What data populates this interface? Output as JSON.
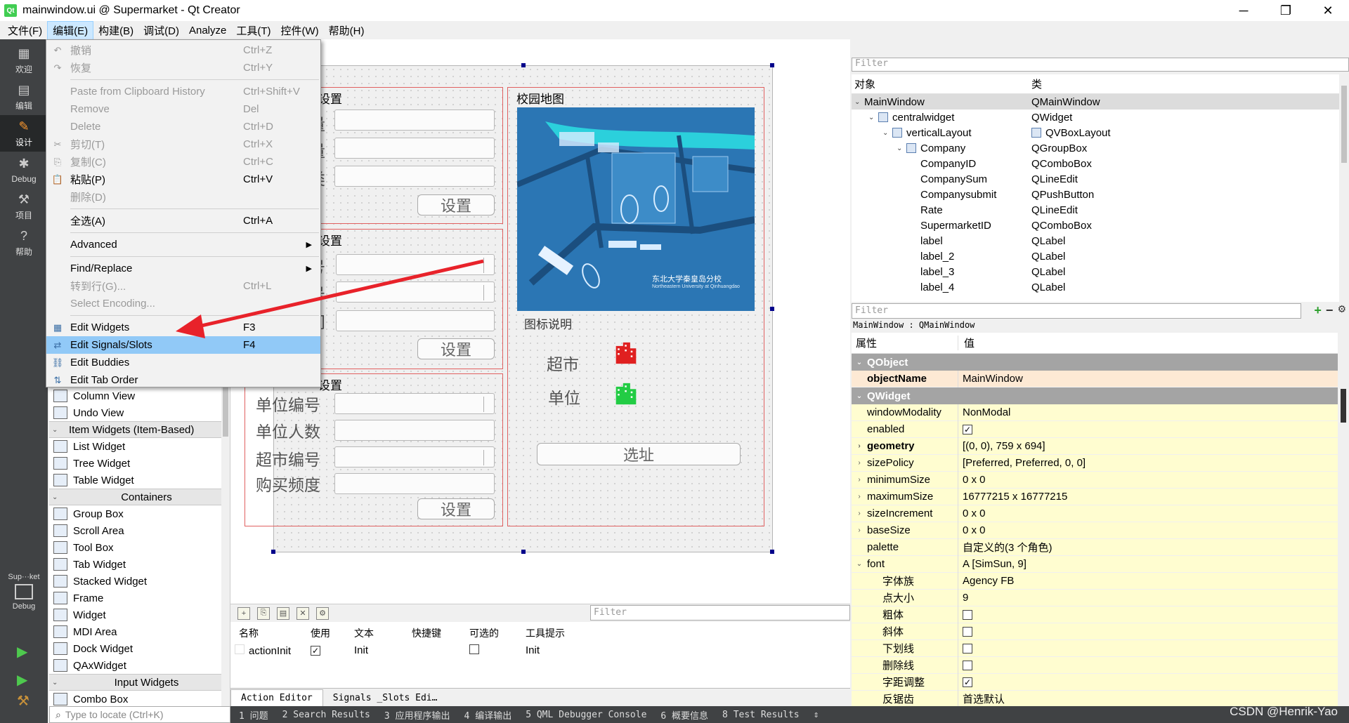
{
  "window": {
    "title": "mainwindow.ui @ Supermarket - Qt Creator",
    "app_icon_label": "Qt",
    "minimize": "─",
    "maximize": "❐",
    "close": "✕"
  },
  "menubar": [
    "文件(F)",
    "编辑(E)",
    "构建(B)",
    "调试(D)",
    "Analyze",
    "工具(T)",
    "控件(W)",
    "帮助(H)"
  ],
  "modes": [
    {
      "label": "欢迎",
      "icon": "grid-icon"
    },
    {
      "label": "编辑",
      "icon": "document-icon"
    },
    {
      "label": "设计",
      "icon": "pencil-icon"
    },
    {
      "label": "Debug",
      "icon": "bug-icon"
    },
    {
      "label": "项目",
      "icon": "wrench-icon"
    },
    {
      "label": "帮助",
      "icon": "help-icon"
    }
  ],
  "kit": {
    "name": "Sup···ket",
    "mode": "Debug"
  },
  "edit_menu": {
    "items": [
      {
        "label": "撤销",
        "shortcut": "Ctrl+Z",
        "disabled": true,
        "icon": "↶"
      },
      {
        "label": "恢复",
        "shortcut": "Ctrl+Y",
        "disabled": true,
        "icon": "↷"
      },
      {
        "sep": true
      },
      {
        "label": "Paste from Clipboard History",
        "shortcut": "Ctrl+Shift+V",
        "disabled": true
      },
      {
        "label": "Remove",
        "shortcut": "Del",
        "disabled": true
      },
      {
        "label": "Delete",
        "shortcut": "Ctrl+D",
        "disabled": true
      },
      {
        "label": "剪切(T)",
        "shortcut": "Ctrl+X",
        "disabled": true,
        "icon": "✂"
      },
      {
        "label": "复制(C)",
        "shortcut": "Ctrl+C",
        "disabled": true,
        "icon": "⎘"
      },
      {
        "label": "粘贴(P)",
        "shortcut": "Ctrl+V",
        "disabled": false,
        "icon": "📋"
      },
      {
        "label": "删除(D)",
        "shortcut": "",
        "disabled": true
      },
      {
        "sep": true
      },
      {
        "label": "全选(A)",
        "shortcut": "Ctrl+A",
        "disabled": false
      },
      {
        "sep": true
      },
      {
        "label": "Advanced",
        "shortcut": "",
        "disabled": false,
        "submenu": true
      },
      {
        "sep": true
      },
      {
        "label": "Find/Replace",
        "shortcut": "",
        "disabled": false,
        "submenu": true
      },
      {
        "label": "转到行(G)...",
        "shortcut": "Ctrl+L",
        "disabled": true
      },
      {
        "label": "Select Encoding...",
        "shortcut": "",
        "disabled": true
      },
      {
        "sep": true
      },
      {
        "label": "Edit Widgets",
        "shortcut": "F3",
        "disabled": false,
        "icon": "▦"
      },
      {
        "label": "Edit Signals/Slots",
        "shortcut": "F4",
        "disabled": false,
        "icon": "⇄",
        "selected": true
      },
      {
        "label": "Edit Buddies",
        "shortcut": "",
        "disabled": false,
        "icon": "⛓"
      },
      {
        "label": "Edit Tab Order",
        "shortcut": "",
        "disabled": false,
        "icon": "⇅"
      }
    ]
  },
  "widget_box": [
    {
      "type": "item",
      "label": "Column View"
    },
    {
      "type": "item",
      "label": "Undo View"
    },
    {
      "type": "cat",
      "label": "Item Widgets (Item-Based)",
      "left": true
    },
    {
      "type": "item",
      "label": "List Widget"
    },
    {
      "type": "item",
      "label": "Tree Widget"
    },
    {
      "type": "item",
      "label": "Table Widget"
    },
    {
      "type": "cat",
      "label": "Containers"
    },
    {
      "type": "item",
      "label": "Group Box"
    },
    {
      "type": "item",
      "label": "Scroll Area"
    },
    {
      "type": "item",
      "label": "Tool Box"
    },
    {
      "type": "item",
      "label": "Tab Widget"
    },
    {
      "type": "item",
      "label": "Stacked Widget"
    },
    {
      "type": "item",
      "label": "Frame"
    },
    {
      "type": "item",
      "label": "Widget"
    },
    {
      "type": "item",
      "label": "MDI Area"
    },
    {
      "type": "item",
      "label": "Dock Widget"
    },
    {
      "type": "item",
      "label": "QAxWidget"
    },
    {
      "type": "cat",
      "label": "Input Widgets"
    },
    {
      "type": "item",
      "label": "Combo Box"
    }
  ],
  "locate_placeholder": "Type to locate (Ctrl+K)",
  "form": {
    "group1": {
      "title": "设置",
      "labels": [
        "量",
        "量",
        "类"
      ],
      "button": "设置"
    },
    "group2": {
      "title": "设置",
      "labels": [
        "号",
        "号",
        "间"
      ],
      "button": "设置"
    },
    "group3": {
      "title": "设置",
      "labels": [
        "单位编号",
        "单位人数",
        "超市编号",
        "购买频度"
      ],
      "button": "设置"
    },
    "map_group": {
      "title": "校园地图",
      "legend_title": "图标说明",
      "legend": [
        "超市",
        "单位"
      ],
      "button": "选址"
    },
    "map_caption": "东北大学秦皇岛分校",
    "map_caption_en": "Northeastern University at Qinhuangdao"
  },
  "action_editor": {
    "filter_placeholder": "Filter",
    "headers": [
      "名称",
      "使用",
      "文本",
      "快捷键",
      "可选的",
      "工具提示"
    ],
    "rows": [
      {
        "name": "actionInit",
        "used": true,
        "text": "Init",
        "shortcut": "",
        "checkable": false,
        "tooltip": "Init"
      }
    ],
    "tabs": [
      "Action Editor",
      "Signals _Slots Edi…"
    ]
  },
  "statusbar": [
    "1 问题",
    "2 Search Results",
    "3 应用程序输出",
    "4 编译输出",
    "5 QML Debugger Console",
    "6 概要信息",
    "8 Test Results",
    "⇕"
  ],
  "watermark": "CSDN @Henrik-Yao",
  "object_inspector": {
    "filter_placeholder": "Filter",
    "headers": [
      "对象",
      "类"
    ],
    "rows": [
      {
        "obj": "MainWindow",
        "cls": "QMainWindow",
        "indent": 0,
        "caret": "⌄",
        "selected": true
      },
      {
        "obj": "centralwidget",
        "cls": "QWidget",
        "indent": 1,
        "caret": "⌄",
        "icon": true
      },
      {
        "obj": "verticalLayout",
        "cls": "QVBoxLayout",
        "indent": 2,
        "caret": "⌄",
        "icon": true,
        "clsicon": true
      },
      {
        "obj": "Company",
        "cls": "QGroupBox",
        "indent": 3,
        "caret": "⌄",
        "icon": true
      },
      {
        "obj": "CompanyID",
        "cls": "QComboBox",
        "indent": 4
      },
      {
        "obj": "CompanySum",
        "cls": "QLineEdit",
        "indent": 4
      },
      {
        "obj": "Companysubmit",
        "cls": "QPushButton",
        "indent": 4
      },
      {
        "obj": "Rate",
        "cls": "QLineEdit",
        "indent": 4
      },
      {
        "obj": "SupermarketID",
        "cls": "QComboBox",
        "indent": 4
      },
      {
        "obj": "label",
        "cls": "QLabel",
        "indent": 4
      },
      {
        "obj": "label_2",
        "cls": "QLabel",
        "indent": 4
      },
      {
        "obj": "label_3",
        "cls": "QLabel",
        "indent": 4
      },
      {
        "obj": "label_4",
        "cls": "QLabel",
        "indent": 4
      }
    ]
  },
  "property_editor": {
    "filter_placeholder": "Filter",
    "class_line": "MainWindow : QMainWindow",
    "headers": [
      "属性",
      "值"
    ],
    "rows": [
      {
        "kind": "group",
        "name": "QObject"
      },
      {
        "kind": "prop",
        "name": "objectName",
        "value": "MainWindow",
        "style": "objectname bold"
      },
      {
        "kind": "group",
        "name": "QWidget"
      },
      {
        "kind": "prop",
        "name": "windowModality",
        "value": "NonModal",
        "style": "qw"
      },
      {
        "kind": "prop",
        "name": "enabled",
        "check": true,
        "style": "qw"
      },
      {
        "kind": "prop",
        "name": "geometry",
        "value": "[(0, 0), 759 x 694]",
        "style": "qw bold",
        "caret": "›"
      },
      {
        "kind": "prop",
        "name": "sizePolicy",
        "value": "[Preferred, Preferred, 0, 0]",
        "style": "qw",
        "caret": "›"
      },
      {
        "kind": "prop",
        "name": "minimumSize",
        "value": "0 x 0",
        "style": "qw",
        "caret": "›"
      },
      {
        "kind": "prop",
        "name": "maximumSize",
        "value": "16777215 x 16777215",
        "style": "qw",
        "caret": "›"
      },
      {
        "kind": "prop",
        "name": "sizeIncrement",
        "value": "0 x 0",
        "style": "qw",
        "caret": "›"
      },
      {
        "kind": "prop",
        "name": "baseSize",
        "value": "0 x 0",
        "style": "qw",
        "caret": "›"
      },
      {
        "kind": "prop",
        "name": "palette",
        "value": "自定义的(3 个角色)",
        "style": "qw"
      },
      {
        "kind": "prop",
        "name": "font",
        "value": "A  [SimSun, 9]",
        "style": "qw",
        "caret": "⌄"
      },
      {
        "kind": "prop",
        "name": "字体族",
        "value": "Agency FB",
        "style": "qw sub"
      },
      {
        "kind": "prop",
        "name": "点大小",
        "value": "9",
        "style": "qw sub"
      },
      {
        "kind": "prop",
        "name": "粗体",
        "check": false,
        "style": "qw sub"
      },
      {
        "kind": "prop",
        "name": "斜体",
        "check": false,
        "style": "qw sub"
      },
      {
        "kind": "prop",
        "name": "下划线",
        "check": false,
        "style": "qw sub"
      },
      {
        "kind": "prop",
        "name": "删除线",
        "check": false,
        "style": "qw sub"
      },
      {
        "kind": "prop",
        "name": "字距调整",
        "check": true,
        "style": "qw sub"
      },
      {
        "kind": "prop",
        "name": "反锯齿",
        "value": "首选默认",
        "style": "qw sub"
      }
    ]
  },
  "colors": {
    "accent": "#91c9f7",
    "map_blue": "#2b76b4",
    "supermarket_icon": "#e02020",
    "unit_icon": "#22cc44",
    "arrow": "#e8222a"
  }
}
